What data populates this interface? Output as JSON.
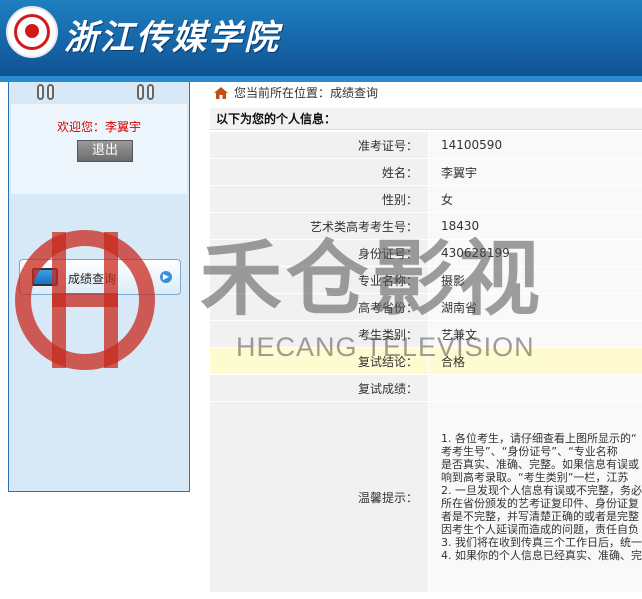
{
  "header": {
    "school_name": "浙江传媒学院"
  },
  "sidebar": {
    "welcome_label": "欢迎您：",
    "user_name": "李翼宇",
    "logout_label": "退出",
    "menu_item_label": "成绩查询"
  },
  "breadcrumb": {
    "text": "您当前所在位置：成绩查询"
  },
  "section_title": "以下为您的个人信息：",
  "rows": [
    {
      "label": "准考证号：",
      "value": "14100590"
    },
    {
      "label": "姓名：",
      "value": "李翼宇"
    },
    {
      "label": "性别：",
      "value": "女"
    },
    {
      "label": "艺术类高考考生号：",
      "value": "18430"
    },
    {
      "label": "身份证号：",
      "value": "430628199"
    },
    {
      "label": "专业名称：",
      "value": "摄影"
    },
    {
      "label": "高考省份：",
      "value": "湖南省"
    },
    {
      "label": "考生类别：",
      "value": "艺兼文"
    },
    {
      "label": "复试结论：",
      "value": "合格"
    },
    {
      "label": "复试成绩：",
      "value": ""
    }
  ],
  "tips": {
    "label": "温馨提示：",
    "lines": [
      "1. 各位考生，请仔细查看上图所显示的“",
      "考考生号”、“身份证号”、“专业名称",
      "是否真实、准确、完整。如果信息有误或",
      "响到高考录取。“考生类别”一栏，江苏",
      "2. 一旦发现个人信息有误或不完整，务必",
      "所在省份颁发的艺考证复印件、身份证复",
      "者是不完整，并写清楚正确的或者是完整",
      "因考生个人延误而造成的问题，责任自负",
      "3. 我们将在收到传真三个工作日后，统一",
      "4. 如果你的个人信息已经真实、准确、完"
    ]
  },
  "watermark": {
    "chinese": "禾仓影视",
    "english": "HECANG TELEVISION"
  }
}
